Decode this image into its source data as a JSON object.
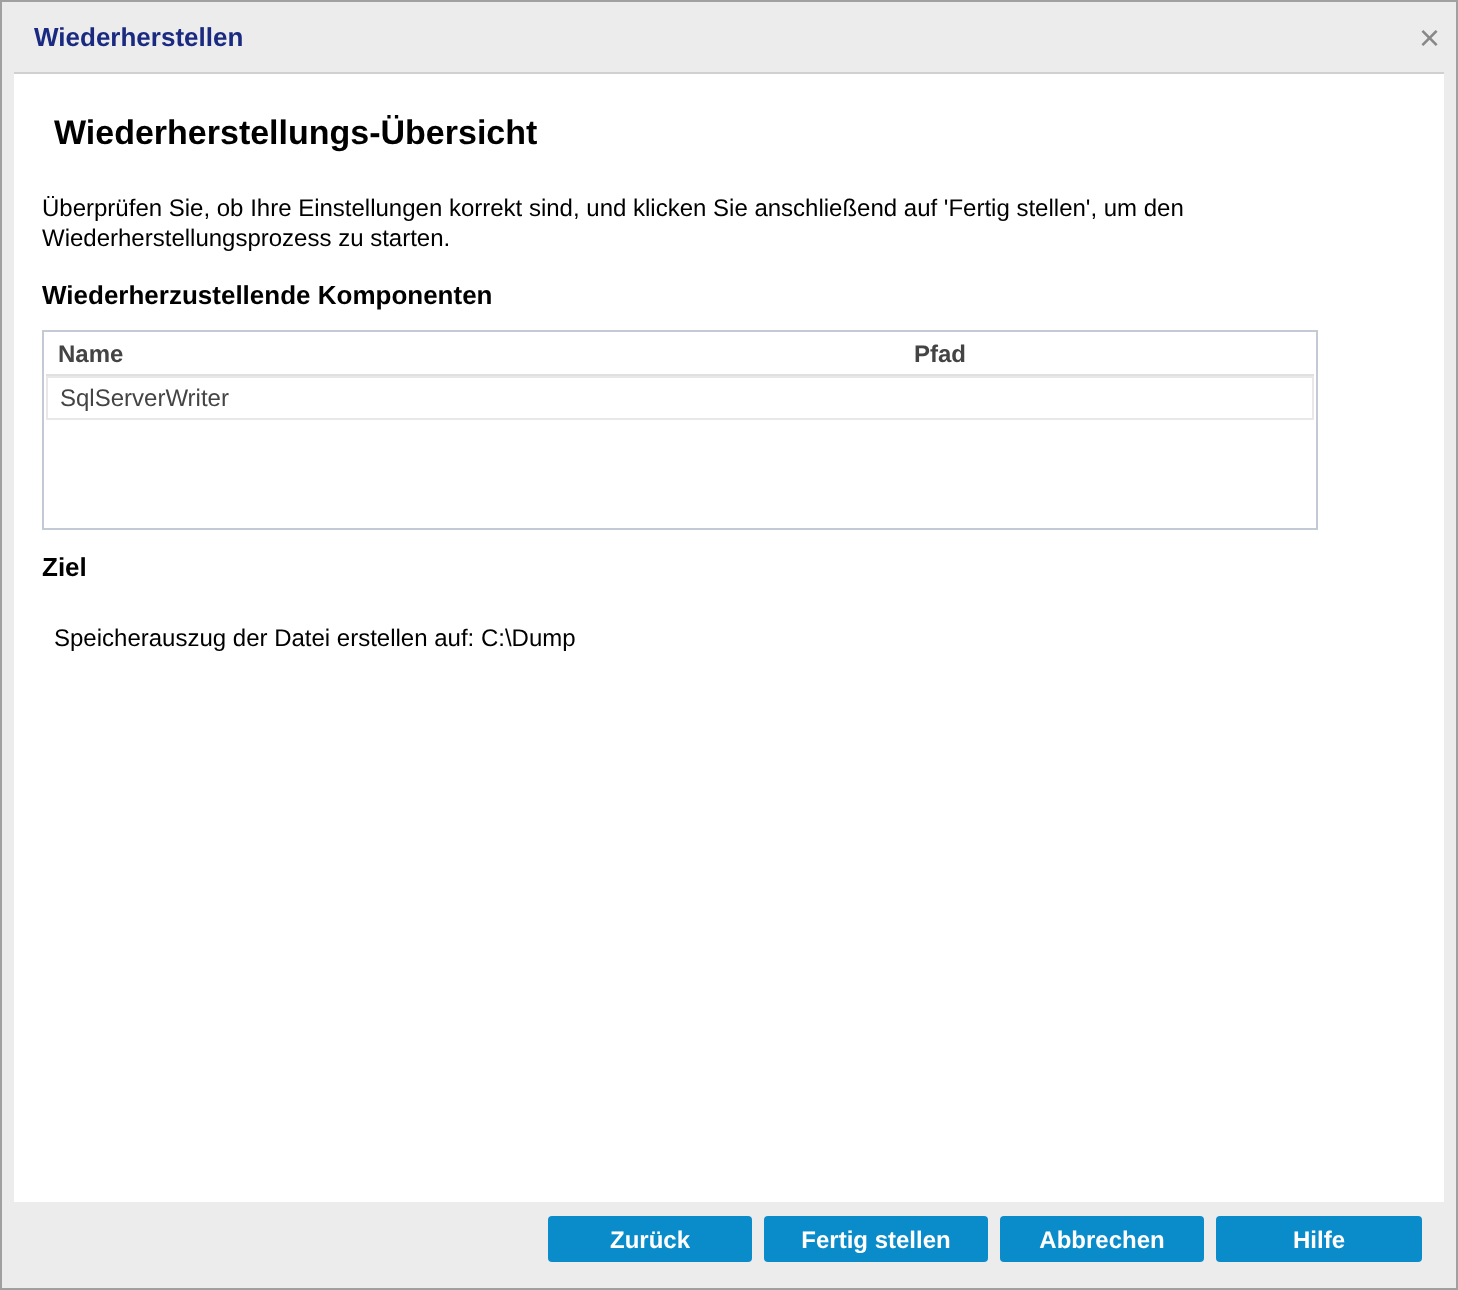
{
  "window": {
    "title": "Wiederherstellen",
    "close": "×"
  },
  "heading": "Wiederherstellungs-Übersicht",
  "intro": "Überprüfen Sie, ob Ihre Einstellungen korrekt sind, und klicken Sie anschließend auf 'Fertig stellen', um den Wiederherstellungsprozess zu starten.",
  "components": {
    "title": "Wiederherzustellende Komponenten",
    "columns": [
      "Name",
      "Pfad"
    ],
    "rows": [
      [
        "SqlServerWriter",
        ""
      ]
    ]
  },
  "target": {
    "title": "Ziel",
    "text": "Speicherauszug der Datei erstellen auf: C:\\Dump"
  },
  "buttons": [
    "Zurück",
    "Fertig stellen",
    "Abbrechen",
    "Hilfe"
  ]
}
